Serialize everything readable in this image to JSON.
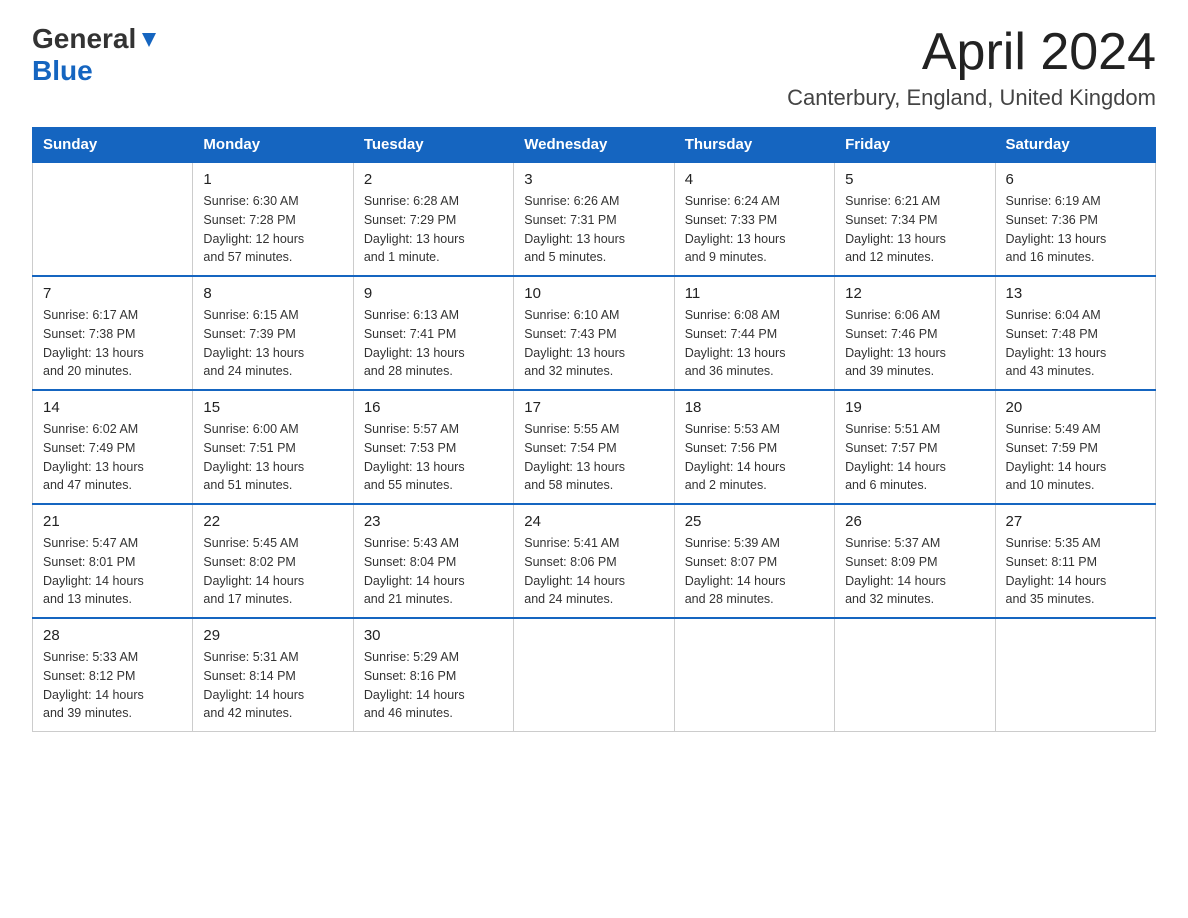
{
  "header": {
    "logo_general": "General",
    "logo_blue": "Blue",
    "month_title": "April 2024",
    "location": "Canterbury, England, United Kingdom"
  },
  "weekdays": [
    "Sunday",
    "Monday",
    "Tuesday",
    "Wednesday",
    "Thursday",
    "Friday",
    "Saturday"
  ],
  "weeks": [
    [
      {
        "day": "",
        "info": ""
      },
      {
        "day": "1",
        "info": "Sunrise: 6:30 AM\nSunset: 7:28 PM\nDaylight: 12 hours\nand 57 minutes."
      },
      {
        "day": "2",
        "info": "Sunrise: 6:28 AM\nSunset: 7:29 PM\nDaylight: 13 hours\nand 1 minute."
      },
      {
        "day": "3",
        "info": "Sunrise: 6:26 AM\nSunset: 7:31 PM\nDaylight: 13 hours\nand 5 minutes."
      },
      {
        "day": "4",
        "info": "Sunrise: 6:24 AM\nSunset: 7:33 PM\nDaylight: 13 hours\nand 9 minutes."
      },
      {
        "day": "5",
        "info": "Sunrise: 6:21 AM\nSunset: 7:34 PM\nDaylight: 13 hours\nand 12 minutes."
      },
      {
        "day": "6",
        "info": "Sunrise: 6:19 AM\nSunset: 7:36 PM\nDaylight: 13 hours\nand 16 minutes."
      }
    ],
    [
      {
        "day": "7",
        "info": "Sunrise: 6:17 AM\nSunset: 7:38 PM\nDaylight: 13 hours\nand 20 minutes."
      },
      {
        "day": "8",
        "info": "Sunrise: 6:15 AM\nSunset: 7:39 PM\nDaylight: 13 hours\nand 24 minutes."
      },
      {
        "day": "9",
        "info": "Sunrise: 6:13 AM\nSunset: 7:41 PM\nDaylight: 13 hours\nand 28 minutes."
      },
      {
        "day": "10",
        "info": "Sunrise: 6:10 AM\nSunset: 7:43 PM\nDaylight: 13 hours\nand 32 minutes."
      },
      {
        "day": "11",
        "info": "Sunrise: 6:08 AM\nSunset: 7:44 PM\nDaylight: 13 hours\nand 36 minutes."
      },
      {
        "day": "12",
        "info": "Sunrise: 6:06 AM\nSunset: 7:46 PM\nDaylight: 13 hours\nand 39 minutes."
      },
      {
        "day": "13",
        "info": "Sunrise: 6:04 AM\nSunset: 7:48 PM\nDaylight: 13 hours\nand 43 minutes."
      }
    ],
    [
      {
        "day": "14",
        "info": "Sunrise: 6:02 AM\nSunset: 7:49 PM\nDaylight: 13 hours\nand 47 minutes."
      },
      {
        "day": "15",
        "info": "Sunrise: 6:00 AM\nSunset: 7:51 PM\nDaylight: 13 hours\nand 51 minutes."
      },
      {
        "day": "16",
        "info": "Sunrise: 5:57 AM\nSunset: 7:53 PM\nDaylight: 13 hours\nand 55 minutes."
      },
      {
        "day": "17",
        "info": "Sunrise: 5:55 AM\nSunset: 7:54 PM\nDaylight: 13 hours\nand 58 minutes."
      },
      {
        "day": "18",
        "info": "Sunrise: 5:53 AM\nSunset: 7:56 PM\nDaylight: 14 hours\nand 2 minutes."
      },
      {
        "day": "19",
        "info": "Sunrise: 5:51 AM\nSunset: 7:57 PM\nDaylight: 14 hours\nand 6 minutes."
      },
      {
        "day": "20",
        "info": "Sunrise: 5:49 AM\nSunset: 7:59 PM\nDaylight: 14 hours\nand 10 minutes."
      }
    ],
    [
      {
        "day": "21",
        "info": "Sunrise: 5:47 AM\nSunset: 8:01 PM\nDaylight: 14 hours\nand 13 minutes."
      },
      {
        "day": "22",
        "info": "Sunrise: 5:45 AM\nSunset: 8:02 PM\nDaylight: 14 hours\nand 17 minutes."
      },
      {
        "day": "23",
        "info": "Sunrise: 5:43 AM\nSunset: 8:04 PM\nDaylight: 14 hours\nand 21 minutes."
      },
      {
        "day": "24",
        "info": "Sunrise: 5:41 AM\nSunset: 8:06 PM\nDaylight: 14 hours\nand 24 minutes."
      },
      {
        "day": "25",
        "info": "Sunrise: 5:39 AM\nSunset: 8:07 PM\nDaylight: 14 hours\nand 28 minutes."
      },
      {
        "day": "26",
        "info": "Sunrise: 5:37 AM\nSunset: 8:09 PM\nDaylight: 14 hours\nand 32 minutes."
      },
      {
        "day": "27",
        "info": "Sunrise: 5:35 AM\nSunset: 8:11 PM\nDaylight: 14 hours\nand 35 minutes."
      }
    ],
    [
      {
        "day": "28",
        "info": "Sunrise: 5:33 AM\nSunset: 8:12 PM\nDaylight: 14 hours\nand 39 minutes."
      },
      {
        "day": "29",
        "info": "Sunrise: 5:31 AM\nSunset: 8:14 PM\nDaylight: 14 hours\nand 42 minutes."
      },
      {
        "day": "30",
        "info": "Sunrise: 5:29 AM\nSunset: 8:16 PM\nDaylight: 14 hours\nand 46 minutes."
      },
      {
        "day": "",
        "info": ""
      },
      {
        "day": "",
        "info": ""
      },
      {
        "day": "",
        "info": ""
      },
      {
        "day": "",
        "info": ""
      }
    ]
  ]
}
